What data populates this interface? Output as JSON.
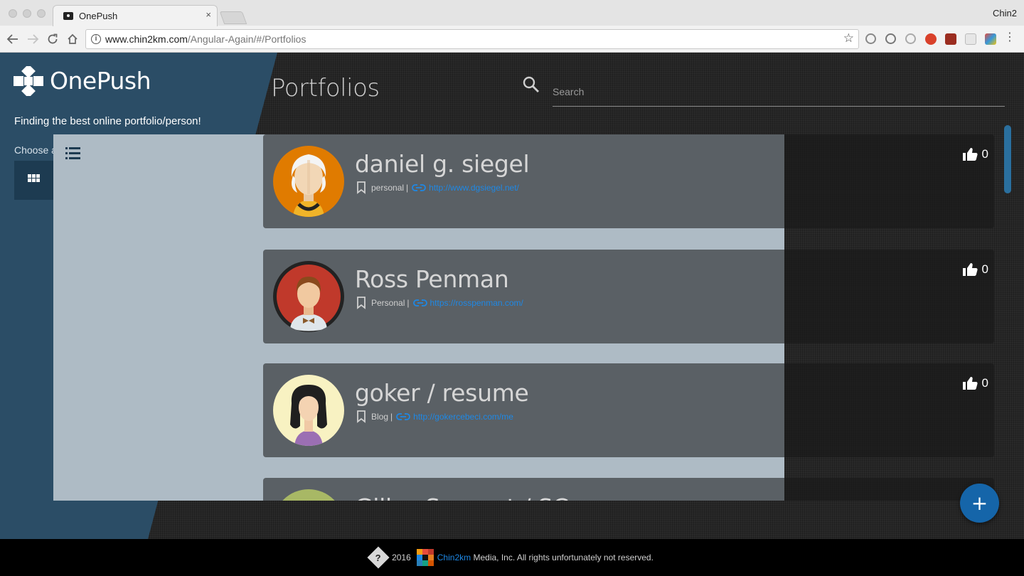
{
  "browser": {
    "tab_title": "OnePush",
    "tab_close": "×",
    "profile_name": "Chin2",
    "url_domain": "www.chin2km.com",
    "url_path": "/Angular-Again/#/Portfolios",
    "extensions": [
      "recycle-icon",
      "sync-icon",
      "ghost-icon",
      "adblock-plus-icon",
      "ublock-icon",
      "grid-extension-icon",
      "colorful-extension-icon"
    ]
  },
  "sidebar": {
    "brand": "OnePush",
    "tagline": "Finding the best online portfolio/person!",
    "layout_label": "Choose a layout",
    "layout_selected": "list",
    "colors": {
      "panel": "#2b4d66",
      "active_layout": "#aebbc5"
    }
  },
  "header": {
    "title": "Portfolios",
    "search_placeholder": "Search"
  },
  "portfolios": [
    {
      "name": "daniel g. siegel",
      "category": "personal",
      "separator": "|",
      "url": "http://www.dgsiegel.net/",
      "likes": "0",
      "avatar": "old-man-avatar",
      "avatar_bg": "#e07b00"
    },
    {
      "name": "Ross Penman",
      "category": "Personal",
      "separator": "|",
      "url": "https://rosspenman.com/",
      "likes": "0",
      "avatar": "man-bowtie-avatar",
      "avatar_bg": "#c0392b"
    },
    {
      "name": "goker / resume",
      "category": "Blog",
      "separator": "|",
      "url": "http://gokercebeci.com/me",
      "likes": "0",
      "avatar": "woman-avatar",
      "avatar_bg": "#f8f2c2"
    },
    {
      "name": "Gilles Sergent / SC",
      "category": "",
      "separator": "",
      "url": "",
      "likes": "",
      "avatar": "partial-avatar",
      "avatar_bg": "#a8b865"
    }
  ],
  "fab": {
    "label": "+"
  },
  "footer": {
    "year": "2016",
    "brand": "Chin2km",
    "text": "Media, Inc. All rights unfortunately not reserved.",
    "badge": "?"
  },
  "colors": {
    "link": "#1e88e5",
    "fab": "#1565a9",
    "footer_bg": "#000000"
  }
}
